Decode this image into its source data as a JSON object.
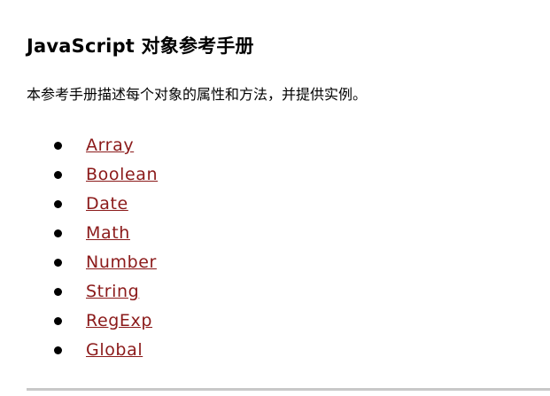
{
  "page": {
    "title": "JavaScript 对象参考手册",
    "intro": "本参考手册描述每个对象的属性和方法，并提供实例。"
  },
  "objects": [
    {
      "label": "Array"
    },
    {
      "label": "Boolean"
    },
    {
      "label": "Date"
    },
    {
      "label": "Math"
    },
    {
      "label": "Number"
    },
    {
      "label": "String"
    },
    {
      "label": "RegExp"
    },
    {
      "label": "Global"
    }
  ],
  "colors": {
    "link": "#8b1a1a",
    "text": "#000000",
    "background": "#ffffff",
    "rule": "#c8c8c8"
  }
}
